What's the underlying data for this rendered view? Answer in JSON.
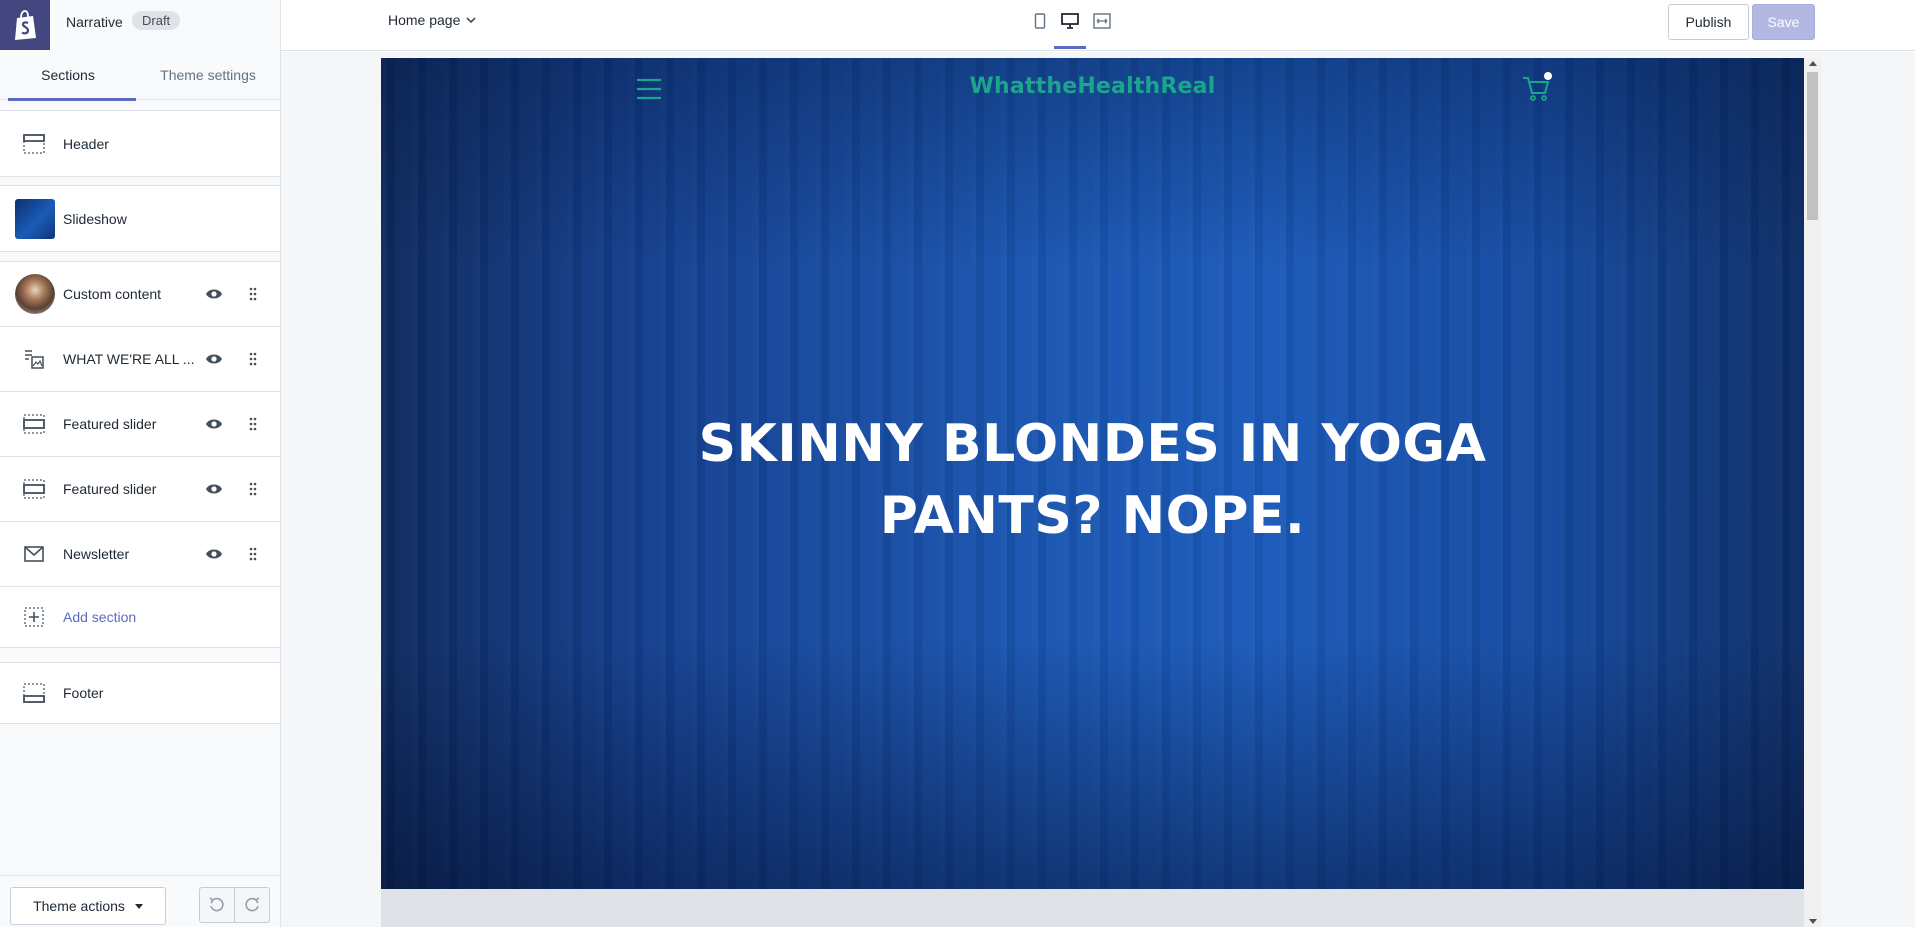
{
  "sidebar": {
    "theme_name": "Narrative",
    "draft_badge": "Draft",
    "tabs": [
      {
        "label": "Sections"
      },
      {
        "label": "Theme settings"
      }
    ],
    "header_section": {
      "label": "Header",
      "icon": "header-section-icon"
    },
    "slideshow_section": {
      "label": "Slideshow",
      "icon": "slideshow-thumbnail"
    },
    "sections": [
      {
        "label": "Custom content",
        "icon": "custom-content-thumbnail"
      },
      {
        "label": "WHAT WE'RE ALL ...",
        "icon": "image-text-icon"
      },
      {
        "label": "Featured slider",
        "icon": "slider-section-icon"
      },
      {
        "label": "Featured slider",
        "icon": "slider-section-icon"
      },
      {
        "label": "Newsletter",
        "icon": "envelope-icon"
      }
    ],
    "add_section": "Add section",
    "footer_section": {
      "label": "Footer",
      "icon": "footer-section-icon"
    },
    "theme_actions": "Theme actions"
  },
  "topbar": {
    "page_select": "Home page",
    "publish": "Publish",
    "save": "Save",
    "active_device": "desktop"
  },
  "preview": {
    "store_name": "WhattheHealthReal",
    "hero_line1": "SKINNY BLONDES IN YOGA",
    "hero_line2": "PANTS? NOPE.",
    "accent_color": "#1aa68a"
  },
  "colors": {
    "brand": "#5c6ac4",
    "logo_bg": "#43467f",
    "save_disabled": "#b3b8e2"
  }
}
